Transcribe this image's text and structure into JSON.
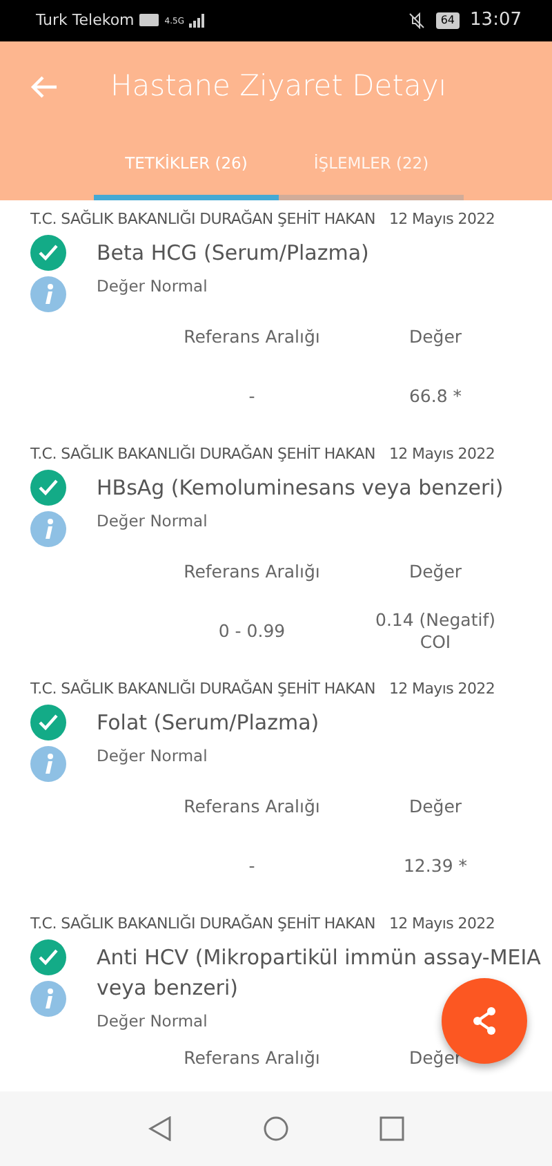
{
  "status_bar": {
    "carrier": "Turk Telekom",
    "network": "4.5G",
    "battery": "64",
    "time": "13:07"
  },
  "header": {
    "title": "Hastane Ziyaret Detayı"
  },
  "tabs": [
    {
      "label": "TETKİKLER (26)",
      "selected": true
    },
    {
      "label": "İŞLEMLER (22)",
      "selected": false
    }
  ],
  "results": [
    {
      "hospital": "T.C. SAĞLIK BAKANLIĞI DURAĞAN ŞEHİT HAKAN",
      "date": "12 Mayıs 2022",
      "test": "Beta HCG (Serum/Plazma)",
      "status": "Değer Normal",
      "range_label": "Referans Aralığı",
      "value_label": "Değer",
      "range": "-",
      "value": "66.8 *",
      "normal": true
    },
    {
      "hospital": "T.C. SAĞLIK BAKANLIĞI DURAĞAN ŞEHİT HAKAN",
      "date": "12 Mayıs 2022",
      "test": "HBsAg (Kemoluminesans veya benzeri)",
      "status": "Değer Normal",
      "range_label": "Referans Aralığı",
      "value_label": "Değer",
      "range": "0 - 0.99",
      "value": "0.14 (Negatif)\nCOI",
      "normal": true
    },
    {
      "hospital": "T.C. SAĞLIK BAKANLIĞI DURAĞAN ŞEHİT HAKAN",
      "date": "12 Mayıs 2022",
      "test": "Folat (Serum/Plazma)",
      "status": "Değer Normal",
      "range_label": "Referans Aralığı",
      "value_label": "Değer",
      "range": "-",
      "value": "12.39 *",
      "normal": true
    },
    {
      "hospital": "T.C. SAĞLIK BAKANLIĞI DURAĞAN ŞEHİT HAKAN",
      "date": "12 Mayıs 2022",
      "test": "Anti HCV (Mikropartikül immün assay-MEIA veya benzeri)",
      "status": "Değer Normal",
      "range_label": "Referans Aralığı",
      "value_label": "Değer",
      "normal": true
    }
  ]
}
